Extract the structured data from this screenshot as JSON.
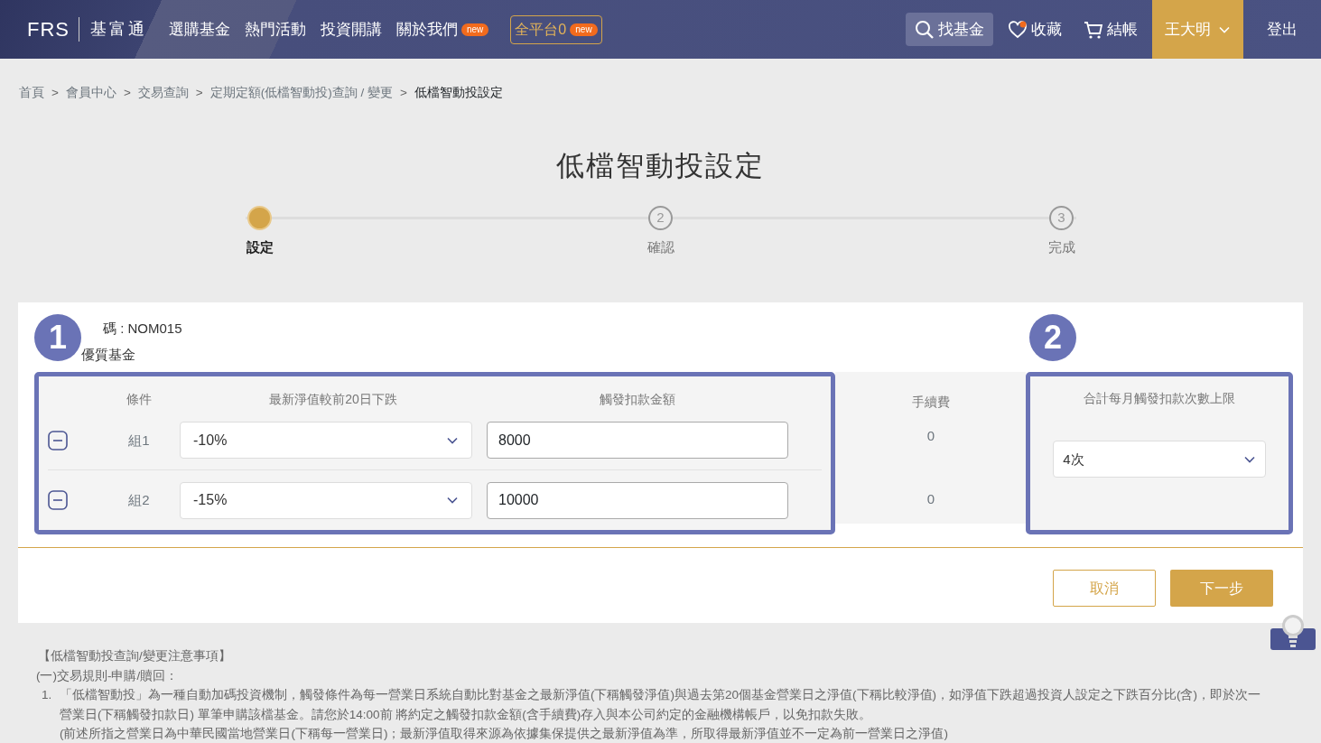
{
  "header": {
    "logo": "FRS",
    "brand": "基富通",
    "nav": [
      {
        "label": "選購基金"
      },
      {
        "label": "熱門活動"
      },
      {
        "label": "投資開講"
      },
      {
        "label": "關於我們",
        "badge": "new"
      }
    ],
    "platform": {
      "label": "全平台0",
      "badge": "new"
    },
    "search": "找基金",
    "favorites": {
      "label": "收藏",
      "has_dot": true
    },
    "checkout": "結帳",
    "user": "王大明",
    "logout": "登出"
  },
  "breadcrumb": [
    {
      "label": "首頁",
      "current": false
    },
    {
      "separator": ">",
      "label": "會員中心",
      "current": false
    },
    {
      "separator": ">",
      "label": "交易查詢",
      "current": false
    },
    {
      "separator": ">",
      "label": "定期定額(低檔智動投)查詢 / 變更",
      "current": false
    },
    {
      "separator": ">",
      "label": "低檔智動投設定",
      "current": true
    }
  ],
  "title": "低檔智動投設定",
  "steps": [
    {
      "label": "設定",
      "current": true
    },
    {
      "number": "2",
      "label": "確認",
      "current": false
    },
    {
      "number": "3",
      "label": "完成",
      "current": false
    }
  ],
  "fund": {
    "code": "碼 : NOM015",
    "name": "優質基金"
  },
  "table": {
    "columns": [
      "條件",
      "最新淨值較前20日下跌",
      "觸發扣款金額",
      "手續費",
      "合計每月觸發扣款次數上限"
    ],
    "rows": [
      {
        "group": "組1",
        "drop": "-10%",
        "amount": "8000",
        "fee": "0"
      },
      {
        "group": "組2",
        "drop": "-15%",
        "amount": "10000",
        "fee": "0"
      }
    ],
    "limit": "4次"
  },
  "annotations": [
    {
      "label": "1"
    },
    {
      "label": "2"
    }
  ],
  "buttons": [
    {
      "label": "取消",
      "kind": "outline"
    },
    {
      "label": "下一步",
      "kind": "primary"
    }
  ],
  "notes": {
    "title": "【低檔智動投查詢/變更注意事項】",
    "subtitle": "(一)交易規則-申購/贖回：",
    "items": [
      {
        "number": "1.",
        "text": "「低檔智動投」為一種自動加碼投資機制，觸發條件為每一營業日系統自動比對基金之最新淨值(下稱觸發淨值)與過去第20個基金營業日之淨值(下稱比較淨值)，如淨值下跌超過投資人設定之下跌百分比(含)，即於次一營業日(下稱觸發扣款日) 單筆申購該檔基金。請您於14:00前 將約定之觸發扣款金額(含手續費)存入與本公司約定的金融機構帳戶，以免扣款失敗。",
        "note": "(前述所指之營業日為中華民國當地營業日(下稱每一營業日)；最新淨值取得來源為依據集保提供之最新淨值為準，所取得最新淨值並不一定為前一營業日之淨值)"
      }
    ]
  }
}
